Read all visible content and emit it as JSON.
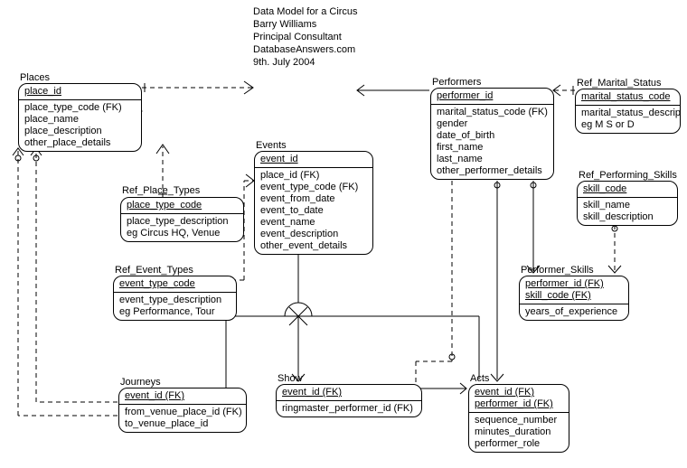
{
  "header": {
    "line1": "Data Model for a Circus",
    "line2": "Barry Williams",
    "line3": "Principal Consultant",
    "line4": "DatabaseAnswers.com",
    "line5": "9th. July 2004"
  },
  "entities": {
    "places": {
      "title": "Places",
      "pk": "place_id",
      "attrs": [
        "place_type_code (FK)",
        "place_name",
        "place_description",
        "other_place_details"
      ]
    },
    "ref_place_types": {
      "title": "Ref_Place_Types",
      "pk": "place_type_code",
      "attrs": [
        "place_type_description",
        "eg Circus HQ, Venue"
      ]
    },
    "ref_event_types": {
      "title": "Ref_Event_Types",
      "pk": "event_type_code",
      "attrs": [
        "event_type_description",
        "eg Performance, Tour"
      ]
    },
    "events": {
      "title": "Events",
      "pk": "event_id",
      "attrs": [
        "place_id (FK)",
        "event_type_code (FK)",
        "event_from_date",
        "event_to_date",
        "event_name",
        "event_description",
        "other_event_details"
      ]
    },
    "performers": {
      "title": "Performers",
      "pk": "performer_id",
      "attrs": [
        "marital_status_code (FK)",
        "gender",
        "date_of_birth",
        "first_name",
        "last_name",
        "other_performer_details"
      ]
    },
    "ref_marital_status": {
      "title": "Ref_Marital_Status",
      "pk": "marital_status_code",
      "attrs": [
        "marital_status_description",
        "eg M S or D"
      ]
    },
    "ref_performing_skills": {
      "title": "Ref_Performing_Skills",
      "pk": "skill_code",
      "attrs": [
        "skill_name",
        "skill_description"
      ]
    },
    "performer_skills": {
      "title": "Performer_Skills",
      "pk": [
        "performer_id (FK)",
        "skill_code (FK)"
      ],
      "attrs": [
        "years_of_experience"
      ]
    },
    "journeys": {
      "title": "Journeys",
      "pk": "event_id (FK)",
      "attrs": [
        "from_venue_place_id (FK)",
        "to_venue_place_id"
      ]
    },
    "show": {
      "title": "Show",
      "pk": "event_id (FK)",
      "attrs": [
        "ringmaster_performer_id (FK)"
      ]
    },
    "acts": {
      "title": "Acts",
      "pk": [
        "event_id (FK)",
        "performer_id (FK)"
      ],
      "attrs": [
        "sequence_number",
        "minutes_duration",
        "performer_role"
      ]
    }
  }
}
